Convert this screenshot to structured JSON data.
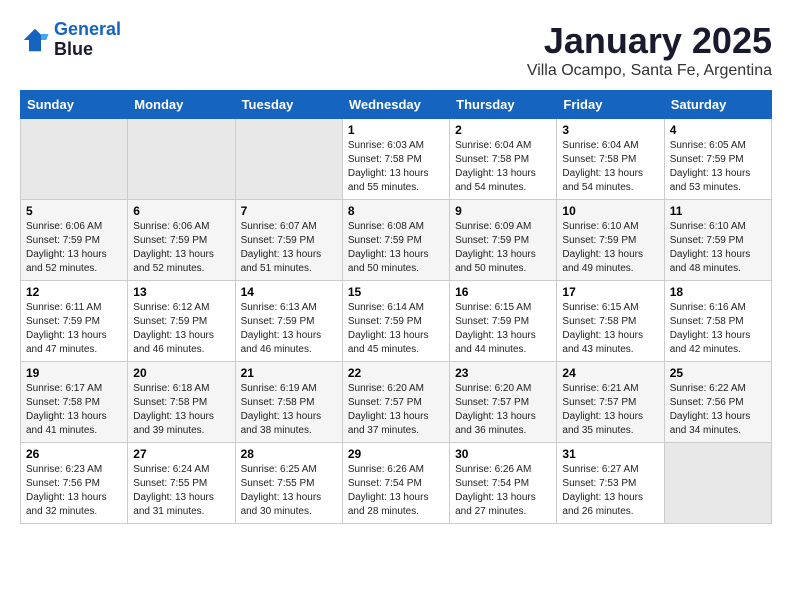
{
  "logo": {
    "line1": "General",
    "line2": "Blue"
  },
  "title": "January 2025",
  "location": "Villa Ocampo, Santa Fe, Argentina",
  "weekdays": [
    "Sunday",
    "Monday",
    "Tuesday",
    "Wednesday",
    "Thursday",
    "Friday",
    "Saturday"
  ],
  "weeks": [
    [
      {
        "day": "",
        "info": ""
      },
      {
        "day": "",
        "info": ""
      },
      {
        "day": "",
        "info": ""
      },
      {
        "day": "1",
        "info": "Sunrise: 6:03 AM\nSunset: 7:58 PM\nDaylight: 13 hours\nand 55 minutes."
      },
      {
        "day": "2",
        "info": "Sunrise: 6:04 AM\nSunset: 7:58 PM\nDaylight: 13 hours\nand 54 minutes."
      },
      {
        "day": "3",
        "info": "Sunrise: 6:04 AM\nSunset: 7:58 PM\nDaylight: 13 hours\nand 54 minutes."
      },
      {
        "day": "4",
        "info": "Sunrise: 6:05 AM\nSunset: 7:59 PM\nDaylight: 13 hours\nand 53 minutes."
      }
    ],
    [
      {
        "day": "5",
        "info": "Sunrise: 6:06 AM\nSunset: 7:59 PM\nDaylight: 13 hours\nand 52 minutes."
      },
      {
        "day": "6",
        "info": "Sunrise: 6:06 AM\nSunset: 7:59 PM\nDaylight: 13 hours\nand 52 minutes."
      },
      {
        "day": "7",
        "info": "Sunrise: 6:07 AM\nSunset: 7:59 PM\nDaylight: 13 hours\nand 51 minutes."
      },
      {
        "day": "8",
        "info": "Sunrise: 6:08 AM\nSunset: 7:59 PM\nDaylight: 13 hours\nand 50 minutes."
      },
      {
        "day": "9",
        "info": "Sunrise: 6:09 AM\nSunset: 7:59 PM\nDaylight: 13 hours\nand 50 minutes."
      },
      {
        "day": "10",
        "info": "Sunrise: 6:10 AM\nSunset: 7:59 PM\nDaylight: 13 hours\nand 49 minutes."
      },
      {
        "day": "11",
        "info": "Sunrise: 6:10 AM\nSunset: 7:59 PM\nDaylight: 13 hours\nand 48 minutes."
      }
    ],
    [
      {
        "day": "12",
        "info": "Sunrise: 6:11 AM\nSunset: 7:59 PM\nDaylight: 13 hours\nand 47 minutes."
      },
      {
        "day": "13",
        "info": "Sunrise: 6:12 AM\nSunset: 7:59 PM\nDaylight: 13 hours\nand 46 minutes."
      },
      {
        "day": "14",
        "info": "Sunrise: 6:13 AM\nSunset: 7:59 PM\nDaylight: 13 hours\nand 46 minutes."
      },
      {
        "day": "15",
        "info": "Sunrise: 6:14 AM\nSunset: 7:59 PM\nDaylight: 13 hours\nand 45 minutes."
      },
      {
        "day": "16",
        "info": "Sunrise: 6:15 AM\nSunset: 7:59 PM\nDaylight: 13 hours\nand 44 minutes."
      },
      {
        "day": "17",
        "info": "Sunrise: 6:15 AM\nSunset: 7:58 PM\nDaylight: 13 hours\nand 43 minutes."
      },
      {
        "day": "18",
        "info": "Sunrise: 6:16 AM\nSunset: 7:58 PM\nDaylight: 13 hours\nand 42 minutes."
      }
    ],
    [
      {
        "day": "19",
        "info": "Sunrise: 6:17 AM\nSunset: 7:58 PM\nDaylight: 13 hours\nand 41 minutes."
      },
      {
        "day": "20",
        "info": "Sunrise: 6:18 AM\nSunset: 7:58 PM\nDaylight: 13 hours\nand 39 minutes."
      },
      {
        "day": "21",
        "info": "Sunrise: 6:19 AM\nSunset: 7:58 PM\nDaylight: 13 hours\nand 38 minutes."
      },
      {
        "day": "22",
        "info": "Sunrise: 6:20 AM\nSunset: 7:57 PM\nDaylight: 13 hours\nand 37 minutes."
      },
      {
        "day": "23",
        "info": "Sunrise: 6:20 AM\nSunset: 7:57 PM\nDaylight: 13 hours\nand 36 minutes."
      },
      {
        "day": "24",
        "info": "Sunrise: 6:21 AM\nSunset: 7:57 PM\nDaylight: 13 hours\nand 35 minutes."
      },
      {
        "day": "25",
        "info": "Sunrise: 6:22 AM\nSunset: 7:56 PM\nDaylight: 13 hours\nand 34 minutes."
      }
    ],
    [
      {
        "day": "26",
        "info": "Sunrise: 6:23 AM\nSunset: 7:56 PM\nDaylight: 13 hours\nand 32 minutes."
      },
      {
        "day": "27",
        "info": "Sunrise: 6:24 AM\nSunset: 7:55 PM\nDaylight: 13 hours\nand 31 minutes."
      },
      {
        "day": "28",
        "info": "Sunrise: 6:25 AM\nSunset: 7:55 PM\nDaylight: 13 hours\nand 30 minutes."
      },
      {
        "day": "29",
        "info": "Sunrise: 6:26 AM\nSunset: 7:54 PM\nDaylight: 13 hours\nand 28 minutes."
      },
      {
        "day": "30",
        "info": "Sunrise: 6:26 AM\nSunset: 7:54 PM\nDaylight: 13 hours\nand 27 minutes."
      },
      {
        "day": "31",
        "info": "Sunrise: 6:27 AM\nSunset: 7:53 PM\nDaylight: 13 hours\nand 26 minutes."
      },
      {
        "day": "",
        "info": ""
      }
    ]
  ]
}
